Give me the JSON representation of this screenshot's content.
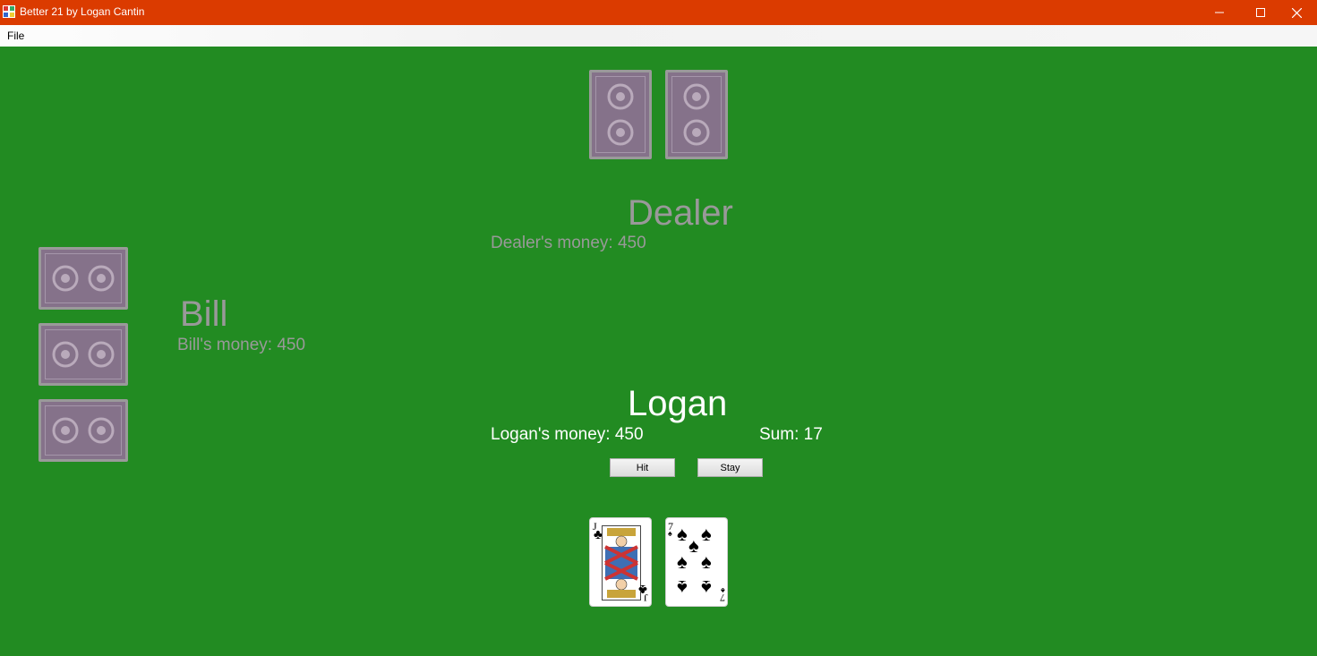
{
  "window": {
    "title": "Better 21 by Logan Cantin",
    "title_color": "#db3b00"
  },
  "menu": {
    "file": "File"
  },
  "table_color": "#228b22",
  "dealer": {
    "name": "Dealer",
    "money": "Dealer's money: 450",
    "cards": [
      "back",
      "back"
    ]
  },
  "bill": {
    "name": "Bill",
    "money": "Bill's money: 450",
    "cards": [
      "back",
      "back",
      "back"
    ]
  },
  "player": {
    "name": "Logan",
    "money": "Logan's money: 450",
    "sum": "Sum: 17",
    "cards": [
      {
        "rank": "J",
        "suit": "clubs",
        "symbol": "♣"
      },
      {
        "rank": "7",
        "suit": "spades",
        "symbol": "♠"
      }
    ]
  },
  "buttons": {
    "hit": "Hit",
    "stay": "Stay"
  },
  "icons": {
    "app": "app-icon",
    "minimize": "minimize-icon",
    "maximize": "maximize-icon",
    "close": "close-icon"
  }
}
